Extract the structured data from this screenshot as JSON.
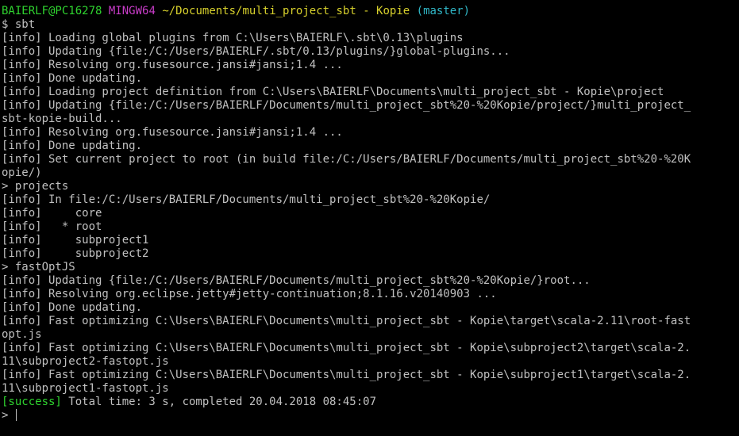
{
  "prompt_header": {
    "user_host": "BAIERLF@PC16278",
    "system": "MINGW64",
    "path": "~/Documents/multi_project_sbt - Kopie",
    "branch": "(master)"
  },
  "command_line": "$ sbt",
  "output_lines": [
    "[info] Loading global plugins from C:\\Users\\BAIERLF\\.sbt\\0.13\\plugins",
    "[info] Updating {file:/C:/Users/BAIERLF/.sbt/0.13/plugins/}global-plugins...",
    "[info] Resolving org.fusesource.jansi#jansi;1.4 ...",
    "[info] Done updating.",
    "[info] Loading project definition from C:\\Users\\BAIERLF\\Documents\\multi_project_sbt - Kopie\\project",
    "[info] Updating {file:/C:/Users/BAIERLF/Documents/multi_project_sbt%20-%20Kopie/project/}multi_project_",
    "sbt-kopie-build...",
    "[info] Resolving org.fusesource.jansi#jansi;1.4 ...",
    "[info] Done updating.",
    "[info] Set current project to root (in build file:/C:/Users/BAIERLF/Documents/multi_project_sbt%20-%20K",
    "opie/)",
    "> projects",
    "[info] In file:/C:/Users/BAIERLF/Documents/multi_project_sbt%20-%20Kopie/",
    "[info]     core",
    "[info]   * root",
    "[info]     subproject1",
    "[info]     subproject2",
    "> fastOptJS",
    "[info] Updating {file:/C:/Users/BAIERLF/Documents/multi_project_sbt%20-%20Kopie/}root...",
    "[info] Resolving org.eclipse.jetty#jetty-continuation;8.1.16.v20140903 ...",
    "[info] Done updating.",
    "[info] Fast optimizing C:\\Users\\BAIERLF\\Documents\\multi_project_sbt - Kopie\\target\\scala-2.11\\root-fast",
    "opt.js",
    "[info] Fast optimizing C:\\Users\\BAIERLF\\Documents\\multi_project_sbt - Kopie\\subproject2\\target\\scala-2.",
    "11\\subproject2-fastopt.js",
    "[info] Fast optimizing C:\\Users\\BAIERLF\\Documents\\multi_project_sbt - Kopie\\subproject1\\target\\scala-2.",
    "11\\subproject1-fastopt.js"
  ],
  "success_line": {
    "tag": "[success]",
    "text": " Total time: 3 s, completed 20.04.2018 08:45:07"
  },
  "input_prompt": "> ",
  "colors": {
    "background": "#000000",
    "text": "#c0c0c0",
    "user_host": "#2fd32f",
    "system": "#c83cc8",
    "path": "#d7d02c",
    "branch": "#30b8c8",
    "success": "#2fd32f"
  }
}
